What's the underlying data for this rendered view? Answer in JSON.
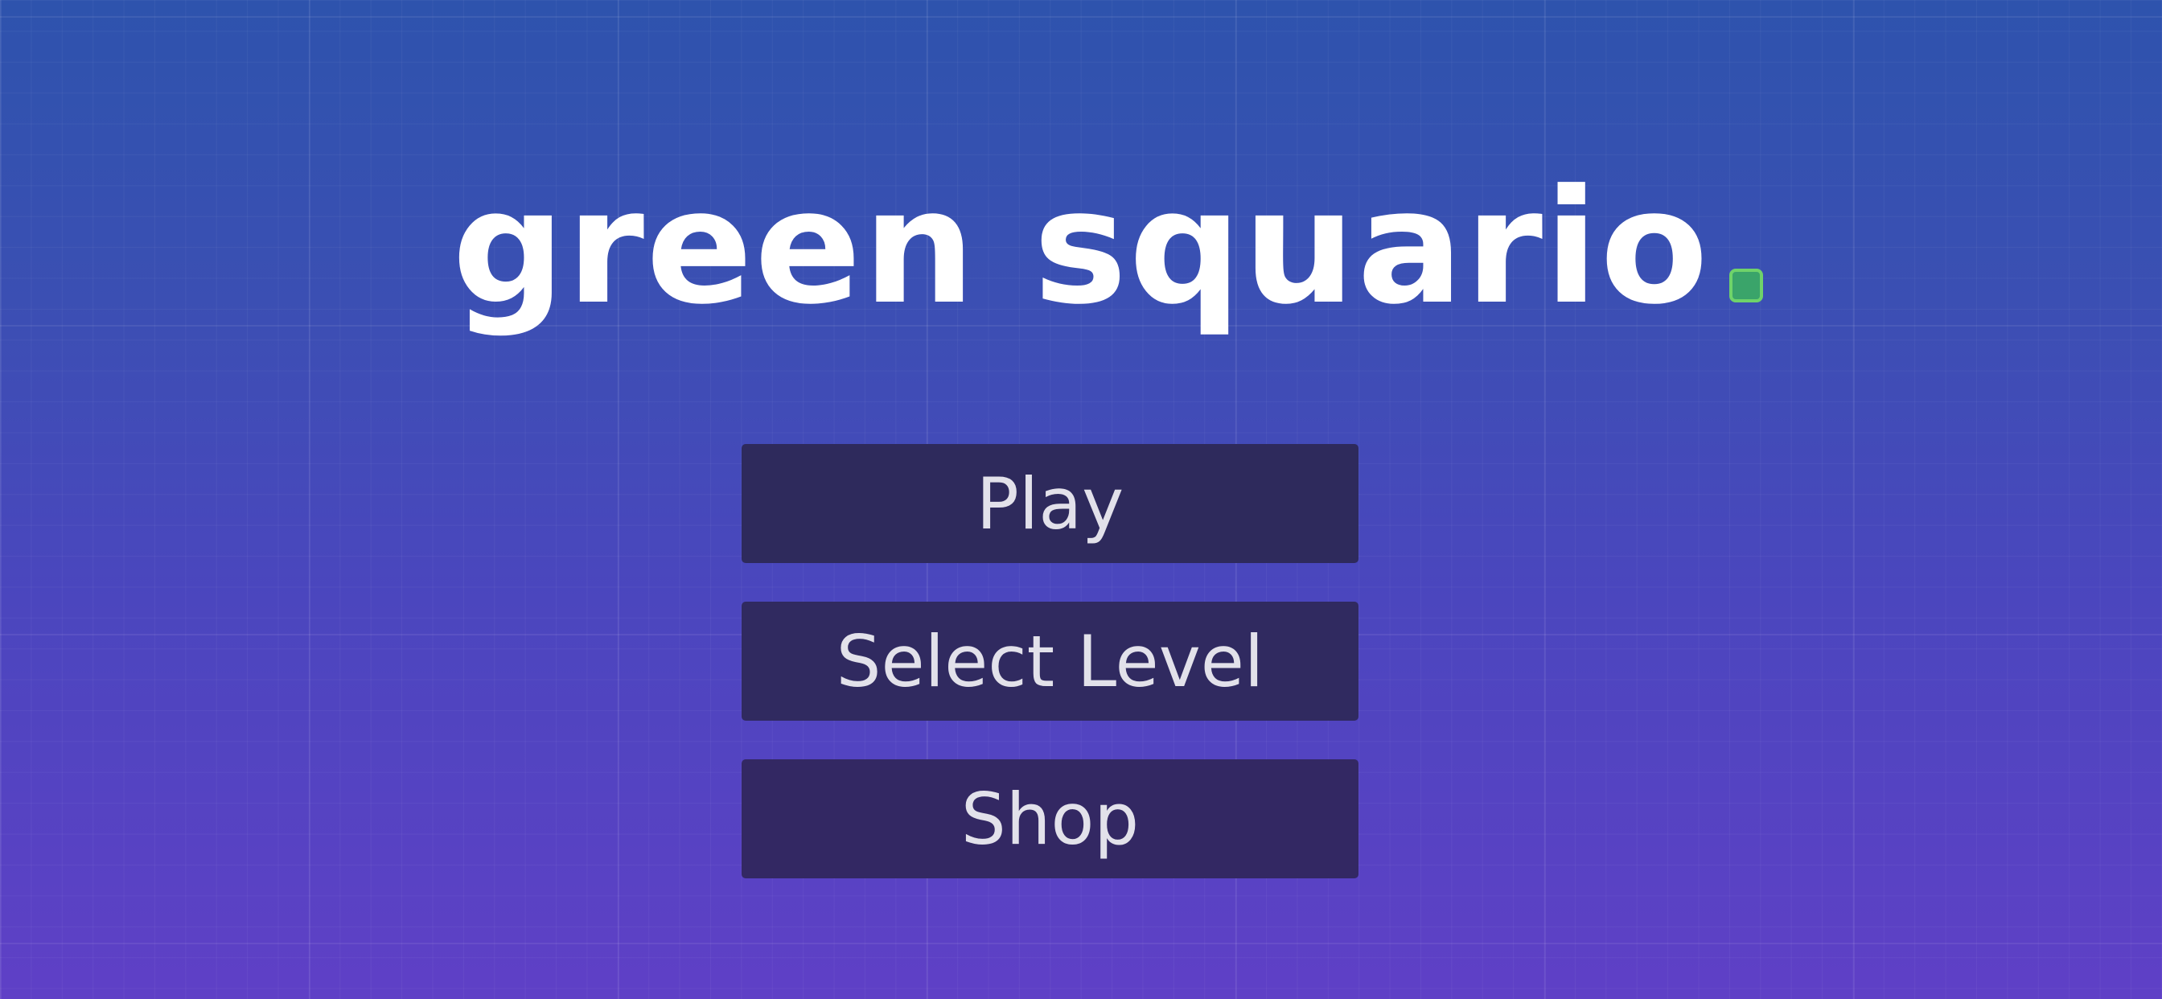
{
  "title": {
    "text": "green squario",
    "square_color": "#3aa46a"
  },
  "menu": {
    "buttons": [
      {
        "label": "Play"
      },
      {
        "label": "Select Level"
      },
      {
        "label": "Shop"
      }
    ]
  },
  "colors": {
    "background_top": "#2e53ad",
    "background_bottom": "#5f40c6",
    "button_fill": "#2e2a5c",
    "button_text": "#e2e1ea"
  }
}
